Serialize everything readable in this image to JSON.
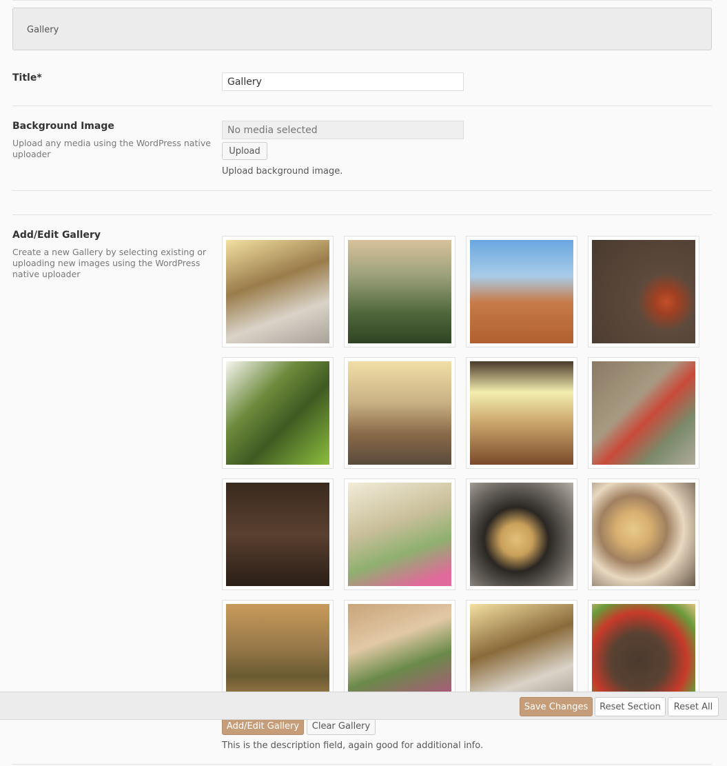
{
  "section": {
    "title": "Gallery"
  },
  "fields": {
    "title": {
      "label": "Title*",
      "value": "Gallery"
    },
    "background": {
      "label": "Background Image",
      "description": "Upload any media using the WordPress native uploader",
      "placeholder": "No media selected",
      "upload_label": "Upload",
      "note": "Upload background image."
    },
    "gallery": {
      "label": "Add/Edit Gallery",
      "description": "Create a new Gallery by selecting existing or uploading new images using the WordPress native uploader",
      "add_label": "Add/Edit Gallery",
      "clear_label": "Clear Gallery",
      "note": "This is the description field, again good for additional info."
    }
  },
  "footer": {
    "save_label": "Save Changes",
    "reset_section_label": "Reset Section",
    "reset_all_label": "Reset All"
  },
  "colors": {
    "accent": "#c69d79"
  }
}
